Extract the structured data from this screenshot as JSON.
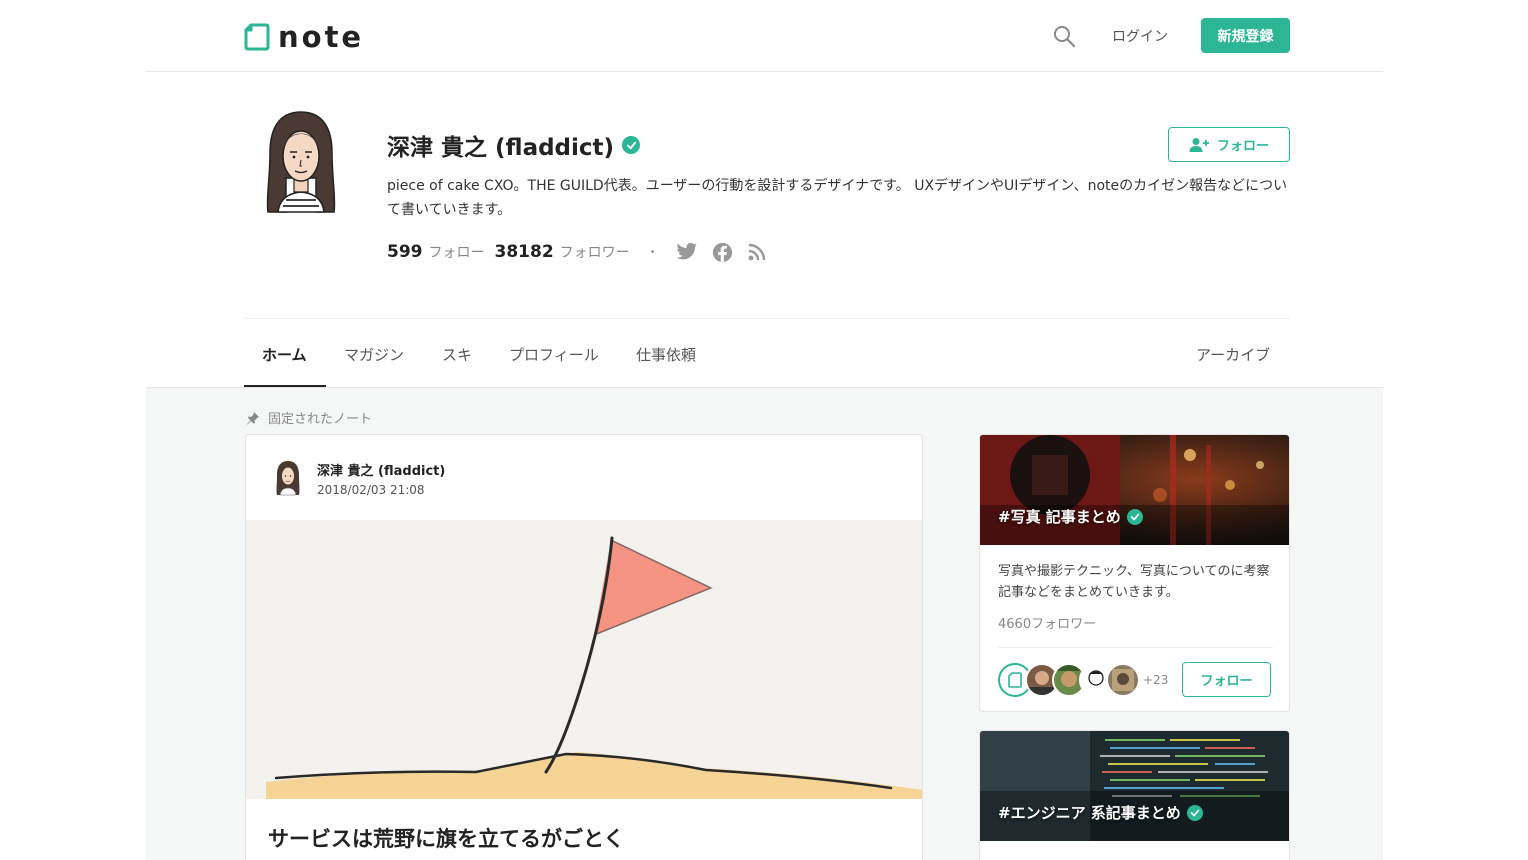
{
  "header": {
    "logo_text": "note",
    "login_label": "ログイン",
    "signup_label": "新規登録",
    "accent_color": "#2cb696"
  },
  "profile": {
    "name": "深津 貴之 (fladdict)",
    "follow_label": "フォロー",
    "bio": "piece of cake CXO。THE GUILD代表。ユーザーの行動を設計するデザイナです。 UXデザインやUIデザイン、noteのカイゼン報告などについて書いていきます。",
    "following_count": "599",
    "following_label": "フォロー",
    "followers_count": "38182",
    "followers_label": "フォロワー",
    "dot": "・",
    "social_icons": [
      "twitter-icon",
      "facebook-icon",
      "rss-icon"
    ]
  },
  "tabs": {
    "home": "ホーム",
    "magazine": "マガジン",
    "likes": "スキ",
    "profile": "プロフィール",
    "work": "仕事依頼",
    "archive": "アーカイブ"
  },
  "pinned": {
    "label": "固定されたノート"
  },
  "note_card": {
    "author": "深津 貴之 (fladdict)",
    "date": "2018/02/03 21:08",
    "title": "サービスは荒野に旗を立てるがごとく"
  },
  "magazines": [
    {
      "title": "#写真 記事まとめ",
      "description": "写真や撮影テクニック、写真についてのに考察記事などをまとめていきます。",
      "followers": "4660フォロワー",
      "member_more": "+23",
      "follow_label": "フォロー"
    },
    {
      "title": "#エンジニア 系記事まとめ"
    }
  ]
}
